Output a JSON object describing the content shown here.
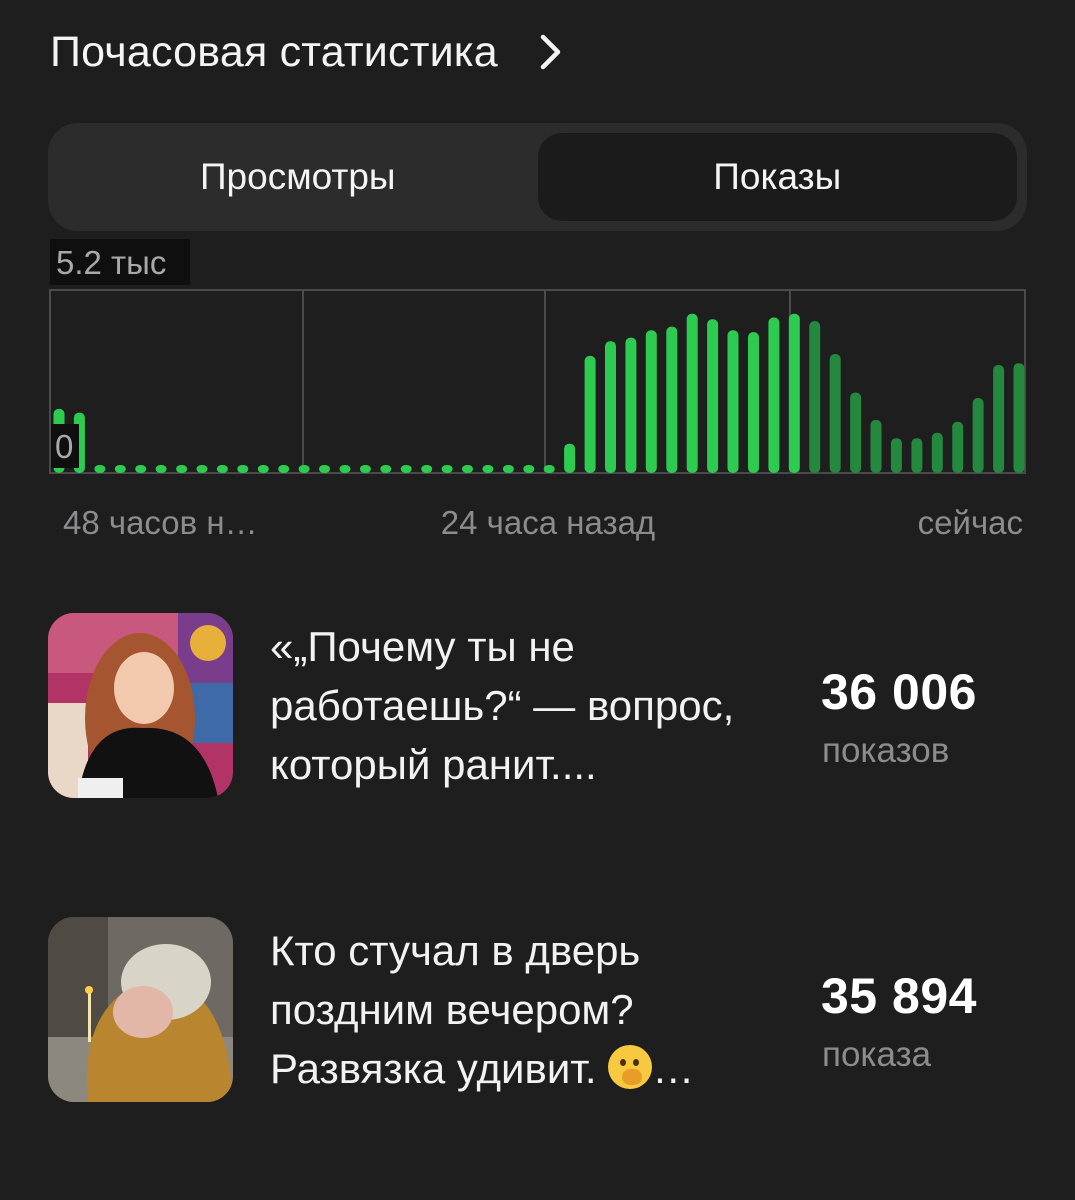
{
  "header": {
    "title": "Почасовая статистика",
    "chevron_icon": "chevron-right-icon"
  },
  "tabs": [
    {
      "label": "Просмотры",
      "active": false
    },
    {
      "label": "Показы",
      "active": true
    }
  ],
  "chart_data": {
    "type": "bar",
    "ymax_label": "5.2 тыс",
    "ymin_label": "0",
    "x_labels": [
      "48 часов н…",
      "24 часа назад",
      "сейчас"
    ],
    "colors": {
      "earlier": "#2dcc51",
      "recent": "#24883e"
    },
    "values": [
      0.35,
      0.33,
      0.04,
      0.04,
      0.04,
      0.04,
      0.04,
      0.04,
      0.04,
      0.04,
      0.04,
      0.04,
      0.04,
      0.04,
      0.04,
      0.04,
      0.04,
      0.04,
      0.04,
      0.04,
      0.04,
      0.04,
      0.04,
      0.04,
      0.04,
      0.16,
      0.64,
      0.72,
      0.74,
      0.78,
      0.8,
      0.87,
      0.84,
      0.78,
      0.77,
      0.85,
      0.87,
      0.83,
      0.65,
      0.44,
      0.29,
      0.19,
      0.19,
      0.22,
      0.28,
      0.41,
      0.59,
      0.6
    ],
    "recent_from_index": 37
  },
  "articles": [
    {
      "title_lines": [
        "«„Почему ты не",
        "работаешь?“ — вопрос,",
        "который ранит...."
      ],
      "stat_value": "36 006",
      "stat_unit": "показов"
    },
    {
      "title_lines": [
        "Кто стучал в дверь",
        "поздним вечером?",
        "Развязка удивит."
      ],
      "title_suffix": "…",
      "emoji_icon": "hand-over-mouth-emoji-icon",
      "stat_value": "35 894",
      "stat_unit": "показа"
    }
  ]
}
